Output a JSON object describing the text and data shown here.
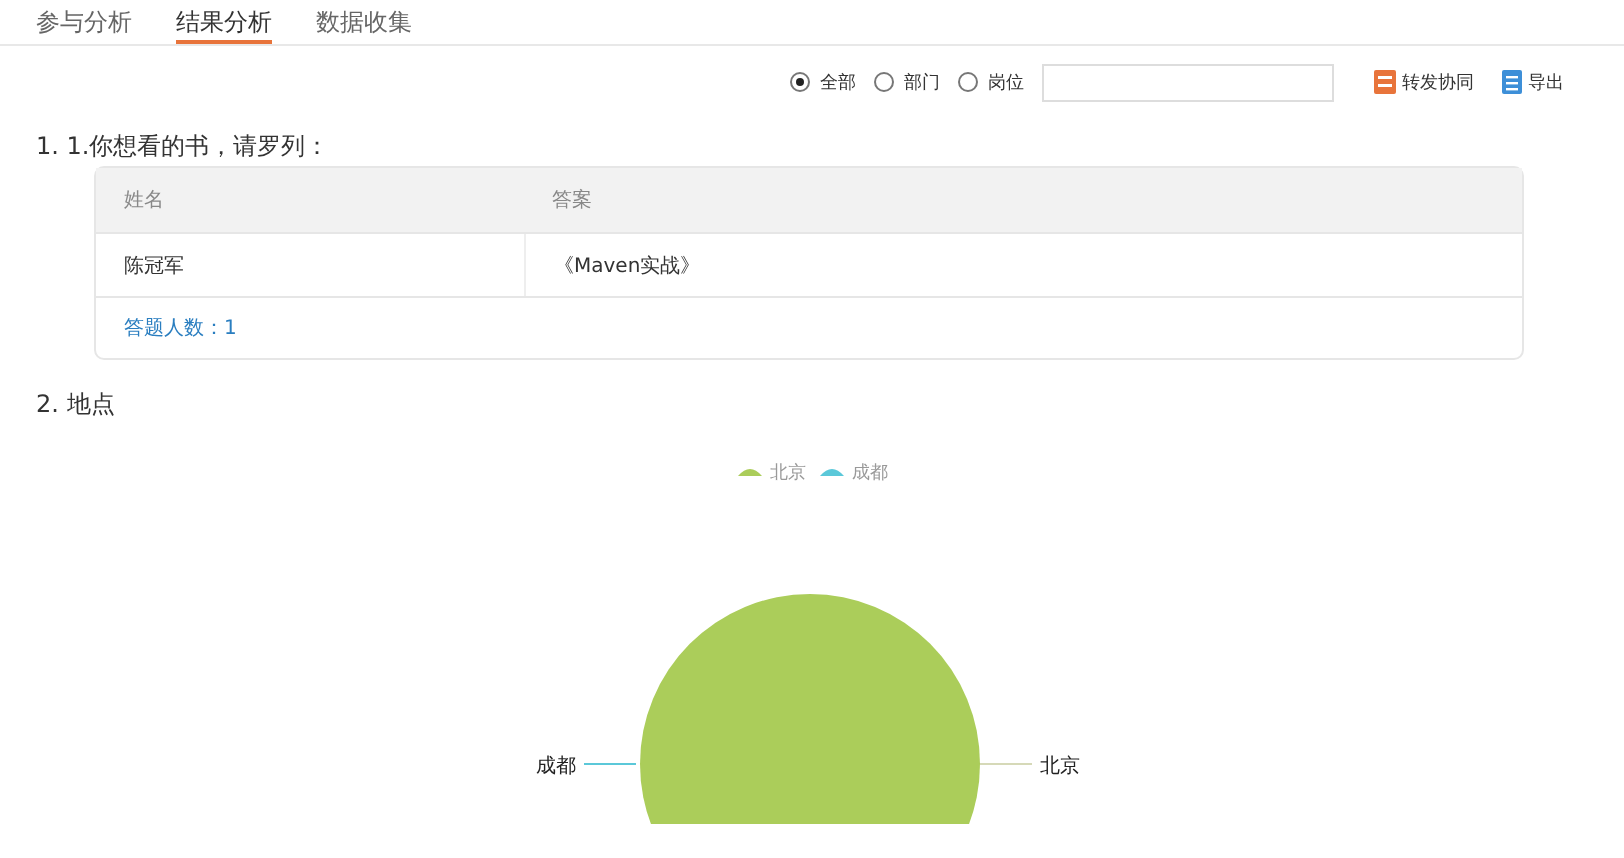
{
  "tabs": [
    {
      "label": "参与分析",
      "selected": false
    },
    {
      "label": "结果分析",
      "selected": true
    },
    {
      "label": "数据收集",
      "selected": false
    }
  ],
  "filter": {
    "options": [
      {
        "label": "全部",
        "selected": true
      },
      {
        "label": "部门",
        "selected": false
      },
      {
        "label": "岗位",
        "selected": false
      }
    ],
    "actions": [
      {
        "kind": "forward",
        "label": "转发协同"
      },
      {
        "kind": "export",
        "label": "导出"
      }
    ]
  },
  "questions": [
    {
      "kind": "table",
      "title": "1. 1.你想看的书，请罗列：",
      "columns": [
        "姓名",
        "答案"
      ],
      "rows": [
        [
          "陈冠军",
          "《Maven实战》"
        ]
      ],
      "footer": "答题人数：1"
    },
    {
      "kind": "chart",
      "title": "2. 地点",
      "legend": [
        {
          "label": "北京",
          "color": "#abcd5a"
        },
        {
          "label": "成都",
          "color": "#5bc8d9"
        }
      ],
      "slice_labels": [
        "成都",
        "北京"
      ]
    }
  ]
}
